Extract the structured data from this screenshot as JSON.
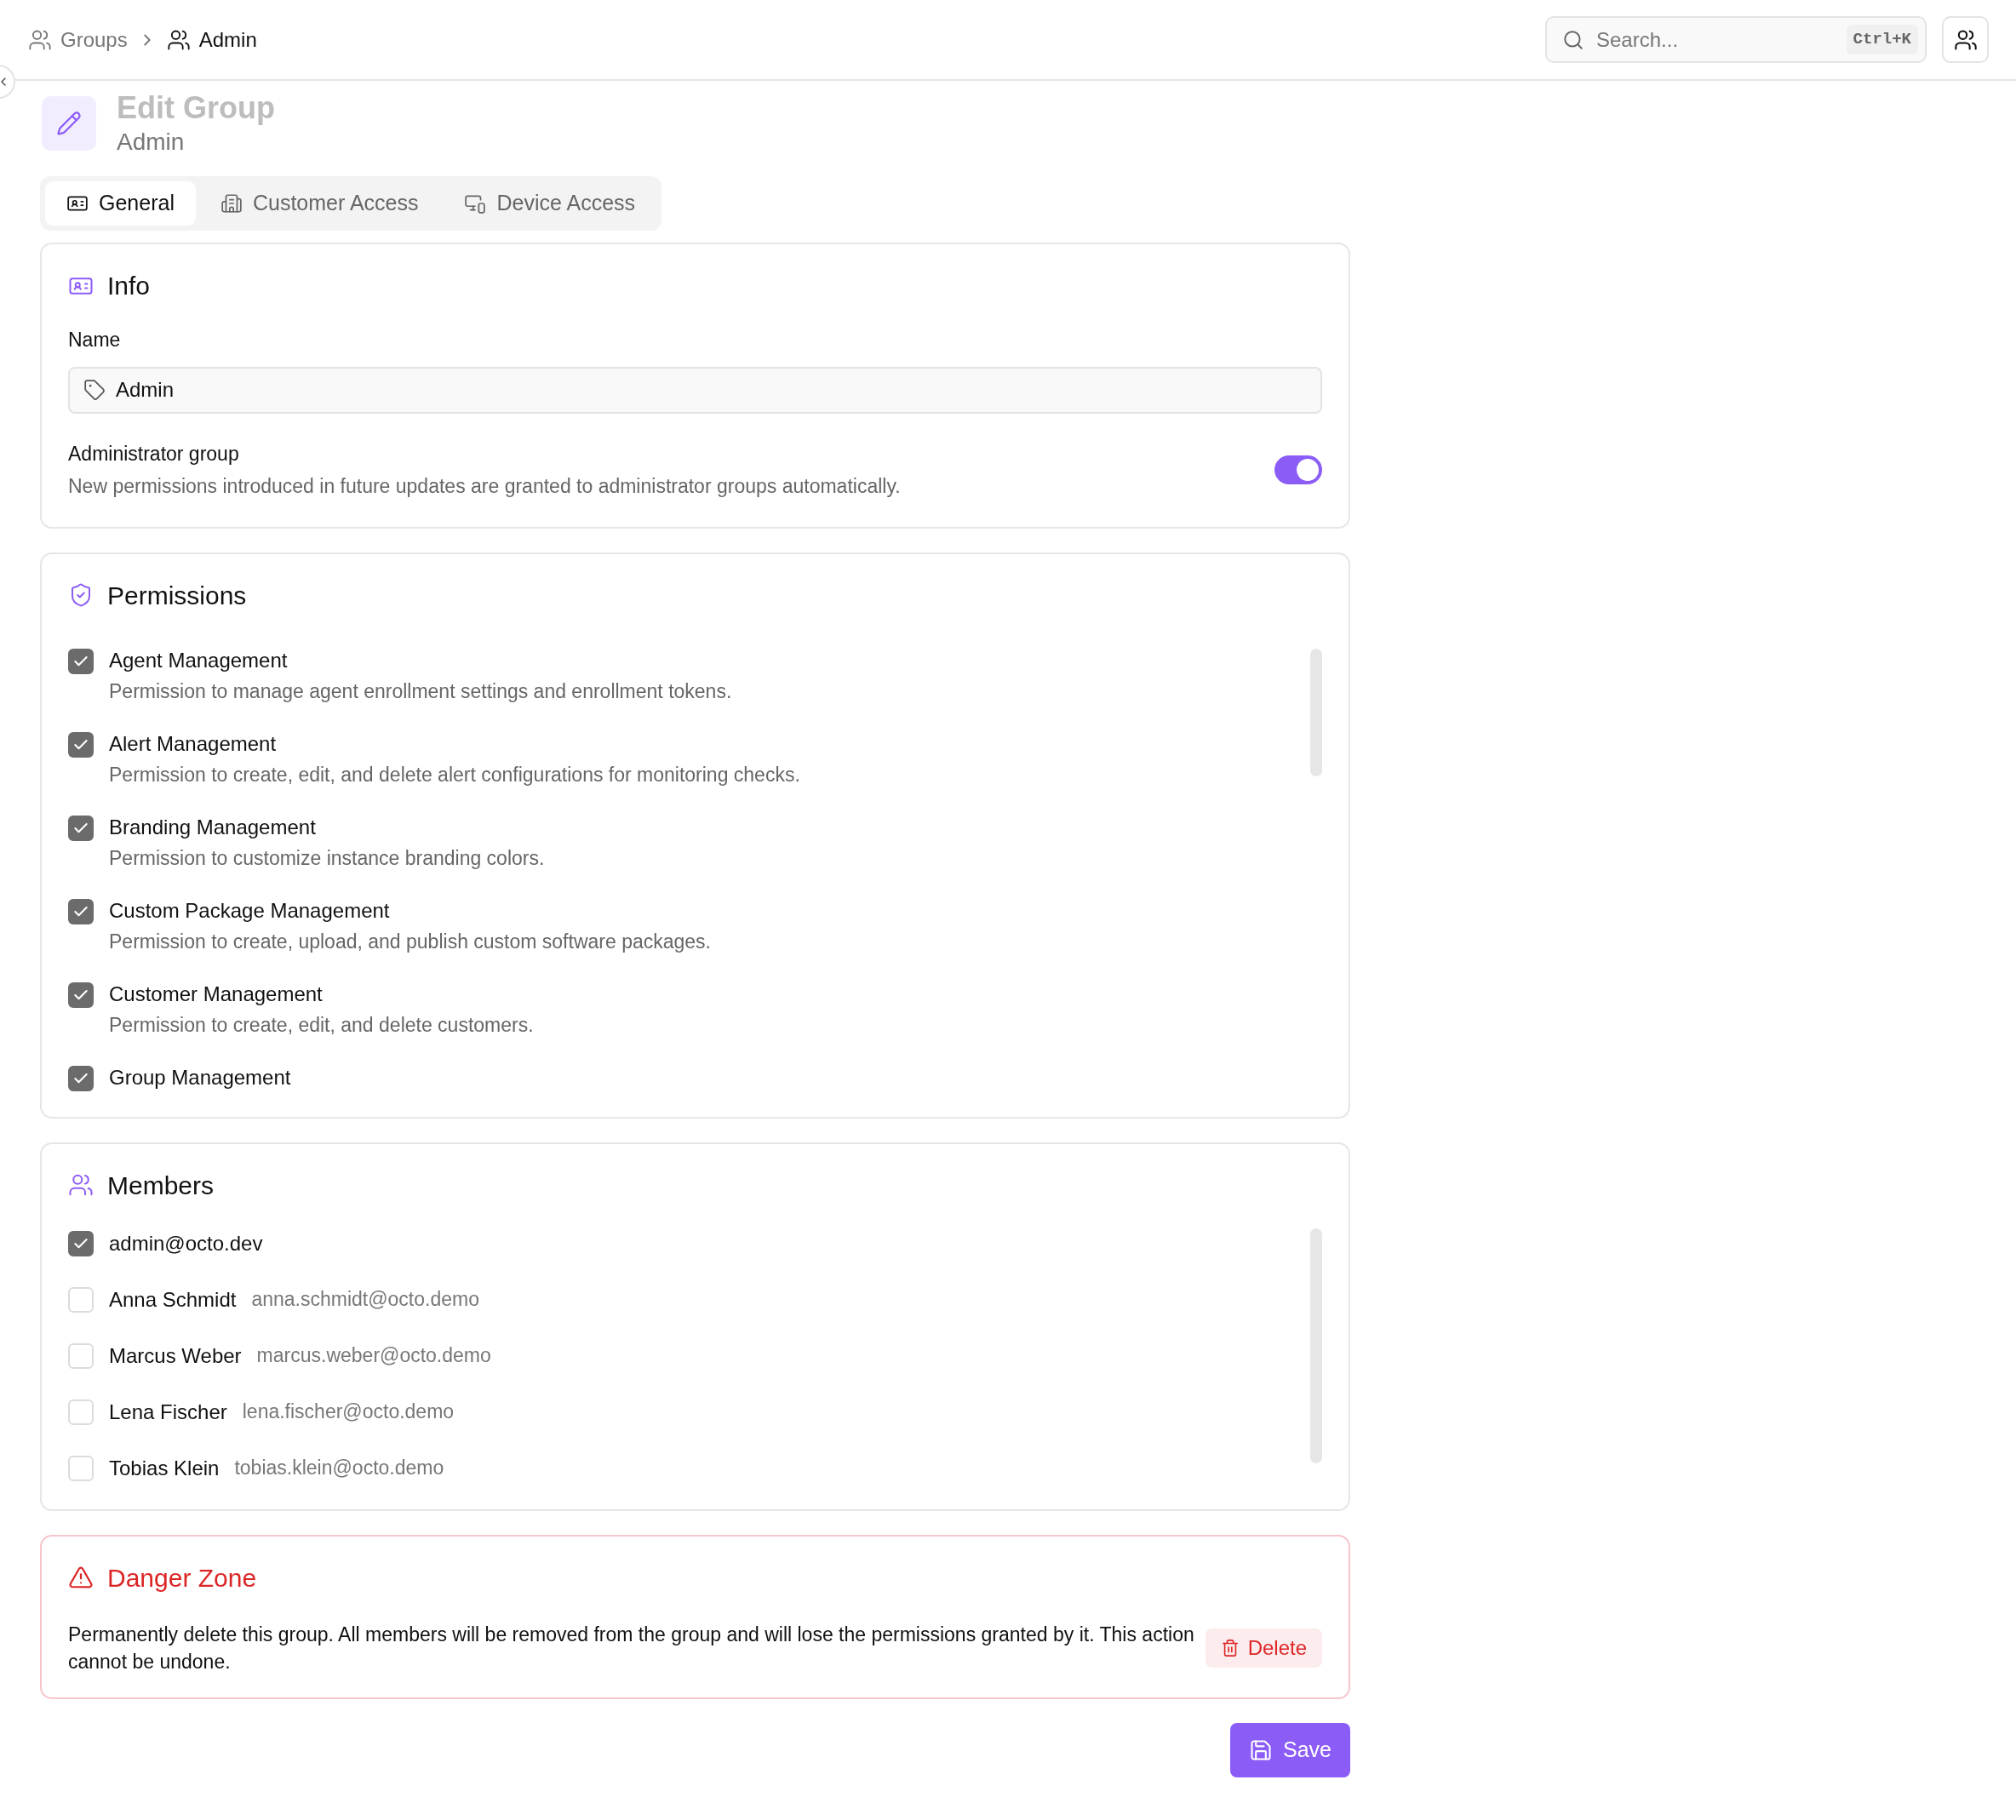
{
  "breadcrumb": [
    {
      "label": "Groups",
      "current": false
    },
    {
      "label": "Admin",
      "current": true
    }
  ],
  "search": {
    "placeholder": "Search...",
    "shortcut": "Ctrl+K"
  },
  "header": {
    "title": "Edit Group",
    "subtitle": "Admin"
  },
  "tabs": [
    {
      "label": "General",
      "selected": true
    },
    {
      "label": "Customer Access",
      "selected": false
    },
    {
      "label": "Device Access",
      "selected": false
    }
  ],
  "info": {
    "title": "Info",
    "name_label": "Name",
    "name_value": "Admin",
    "admin_label": "Administrator group",
    "admin_description": "New permissions introduced in future updates are granted to administrator groups automatically.",
    "admin_on": true
  },
  "permissions": {
    "title": "Permissions",
    "items": [
      {
        "name": "Agent Management",
        "description": "Permission to manage agent enrollment settings and enrollment tokens.",
        "checked": true
      },
      {
        "name": "Alert Management",
        "description": "Permission to create, edit, and delete alert configurations for monitoring checks.",
        "checked": true
      },
      {
        "name": "Branding Management",
        "description": "Permission to customize instance branding colors.",
        "checked": true
      },
      {
        "name": "Custom Package Management",
        "description": "Permission to create, upload, and publish custom software packages.",
        "checked": true
      },
      {
        "name": "Customer Management",
        "description": "Permission to create, edit, and delete customers.",
        "checked": true
      },
      {
        "name": "Group Management",
        "checked": true
      }
    ]
  },
  "members": {
    "title": "Members",
    "items": [
      {
        "name": "admin@octo.dev",
        "checked": true
      },
      {
        "name": "Anna Schmidt",
        "email": "anna.schmidt@octo.demo",
        "checked": false
      },
      {
        "name": "Marcus Weber",
        "email": "marcus.weber@octo.demo",
        "checked": false
      },
      {
        "name": "Lena Fischer",
        "email": "lena.fischer@octo.demo",
        "checked": false
      },
      {
        "name": "Tobias Klein",
        "email": "tobias.klein@octo.demo",
        "checked": false
      }
    ]
  },
  "danger": {
    "title": "Danger Zone",
    "text": "Permanently delete this group. All members will be removed from the group and will lose the permissions granted by it. This action cannot be undone.",
    "button": "Delete"
  },
  "save": "Save"
}
